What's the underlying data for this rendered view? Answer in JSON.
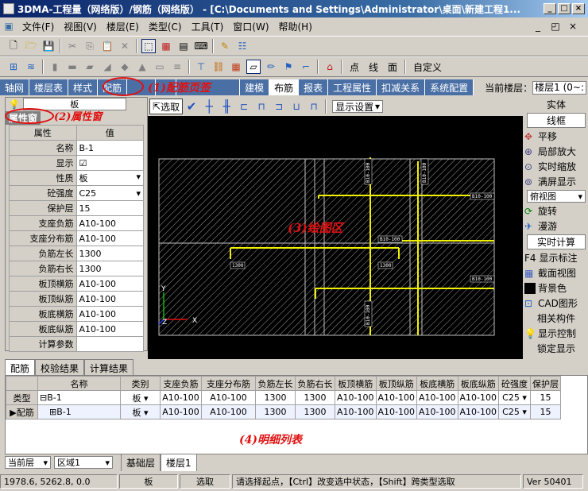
{
  "window": {
    "title": "3DMA-工程量（网络版）/钢筋（网络版） - [C:\\Documents and Settings\\Administrator\\桌面\\新建工程1...",
    "min": "_",
    "max": "□",
    "close": "×"
  },
  "menu": [
    "文件(F)",
    "视图(V)",
    "楼层(E)",
    "类型(C)",
    "工具(T)",
    "窗口(W)",
    "帮助(H)"
  ],
  "toolbar2_text": {
    "point": "点",
    "line": "线",
    "face": "面",
    "custom": "自定义"
  },
  "tabs": [
    {
      "label": "轴网"
    },
    {
      "label": "楼层表"
    },
    {
      "label": "样式"
    },
    {
      "label": "配筋"
    },
    {
      "label": "(1)"
    },
    {
      "label": "地"
    },
    {
      "label": "配筋页签"
    },
    {
      "label": "建模"
    },
    {
      "label": "布筋"
    },
    {
      "label": "报表"
    },
    {
      "label": "工程属性"
    },
    {
      "label": "扣减关系"
    },
    {
      "label": "系统配置"
    }
  ],
  "current_floor": {
    "label": "当前楼层：",
    "value": "楼层1 (0~:"
  },
  "annotations": {
    "a1": "(1)配筋页签",
    "a2": "(2)属性窗",
    "a3": "(3)绘图区",
    "a4": "(4)明细列表"
  },
  "property": {
    "selector_value": "板",
    "title": "属性窗",
    "headers": {
      "k": "属性",
      "v": "值"
    },
    "rows": [
      {
        "k": "名称",
        "v": "B-1"
      },
      {
        "k": "显示",
        "v": "☑"
      },
      {
        "k": "性质",
        "v": "板"
      },
      {
        "k": "砼强度",
        "v": "C25"
      },
      {
        "k": "保护层",
        "v": "15"
      },
      {
        "k": "支座负筋",
        "v": "A10-100"
      },
      {
        "k": "支座分布筋",
        "v": "A10-100"
      },
      {
        "k": "负筋左长",
        "v": "1300"
      },
      {
        "k": "负筋右长",
        "v": "1300"
      },
      {
        "k": "板顶横筋",
        "v": "A10-100"
      },
      {
        "k": "板顶纵筋",
        "v": "A10-100"
      },
      {
        "k": "板底横筋",
        "v": "A10-100"
      },
      {
        "k": "板底纵筋",
        "v": "A10-100"
      },
      {
        "k": "计算参数",
        "v": ""
      }
    ]
  },
  "drawtb": {
    "select": "选取",
    "display": "显示设置"
  },
  "canvas_labels": {
    "a": "B10-100",
    "b": "B10-100",
    "c": "B10-100",
    "d": "B10-100",
    "e": "1300",
    "f": "1300",
    "g": "B10-100",
    "h": "B10-100",
    "axis_y": "Y",
    "axis_z": "Z",
    "axis_x": "X"
  },
  "rightpanel": {
    "entity": "实体",
    "wire": "线框",
    "pan": "平移",
    "zoom_local": "局部放大",
    "zoom_rt": "实时缩放",
    "fit": "满屏显示",
    "view": "俯视图",
    "rotate": "旋转",
    "roam": "漫游",
    "calc": "实时计算",
    "f4": "F4",
    "show_label": "显示标注",
    "section": "截面视图",
    "bg": "背景色",
    "cad": "CAD图形",
    "related": "相关构件",
    "display_ctrl": "显示控制",
    "lock": "锁定显示"
  },
  "bottom_tabs": [
    "配筋",
    "校验结果",
    "计算结果"
  ],
  "grid": {
    "headers": [
      "",
      "名称",
      "类别",
      "支座负筋",
      "支座分布筋",
      "负筋左长",
      "负筋右长",
      "板顶横筋",
      "板顶纵筋",
      "板底横筋",
      "板底纵筋",
      "砼强度",
      "保护层"
    ],
    "rows": [
      {
        "c0": "类型",
        "c1": "⊟B-1",
        "c2": "板",
        "c3": "A10-100",
        "c4": "A10-100",
        "c5": "1300",
        "c6": "1300",
        "c7": "A10-100",
        "c8": "A10-100",
        "c9": "A10-100",
        "c10": "A10-100",
        "c11": "C25",
        "c12": "15"
      },
      {
        "c0": "配筋",
        "c1": "⊞B-1",
        "c2": "板",
        "c3": "A10-100",
        "c4": "A10-100",
        "c5": "1300",
        "c6": "1300",
        "c7": "A10-100",
        "c8": "A10-100",
        "c9": "A10-100",
        "c10": "A10-100",
        "c11": "C25",
        "c12": "15"
      }
    ]
  },
  "floorbar": {
    "cur_label": "当前层",
    "region": "区域1",
    "tab1": "基础层",
    "tab2": "楼层1"
  },
  "status": {
    "coords": "1978.6, 5262.8, 0.0",
    "type": "板",
    "mode": "选取",
    "hint": "请选择起点，【Ctrl】改变选中状态，【Shift】跨类型选取",
    "ver": "Ver 50401"
  }
}
